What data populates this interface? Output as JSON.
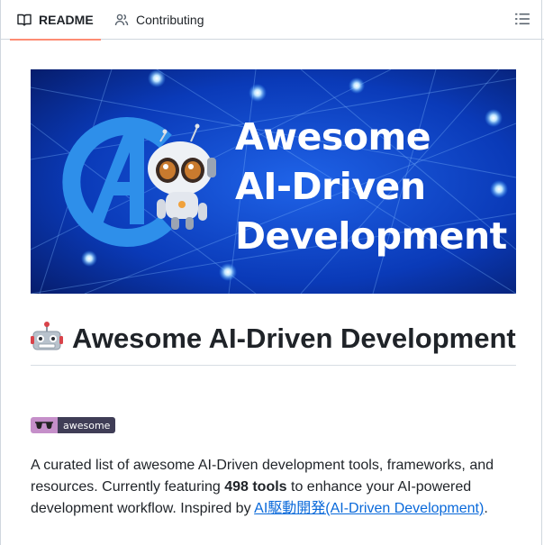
{
  "tabs": [
    {
      "label": "README",
      "icon": "book-icon",
      "active": true
    },
    {
      "label": "Contributing",
      "icon": "people-icon",
      "active": false
    }
  ],
  "outline_icon": "list-unordered-icon",
  "banner": {
    "line1": "Awesome",
    "line2": "AI-Driven",
    "line3": "Development"
  },
  "heading": {
    "emoji": "robot-icon",
    "text": "Awesome AI-Driven Development"
  },
  "badge": {
    "icon": "sunglasses-icon",
    "label": "awesome"
  },
  "description": {
    "part1": "A curated list of awesome AI-Driven development tools, frameworks, and resources. Currently featuring ",
    "bold": "498 tools",
    "part2": " to enhance your AI-powered development workflow. Inspired by ",
    "link": "AI駆動開発(AI-Driven Development)",
    "part3": "."
  },
  "colors": {
    "active_tab_underline": "#fd8c73",
    "link": "#0969da",
    "banner_bg": "#0a2fa8"
  }
}
